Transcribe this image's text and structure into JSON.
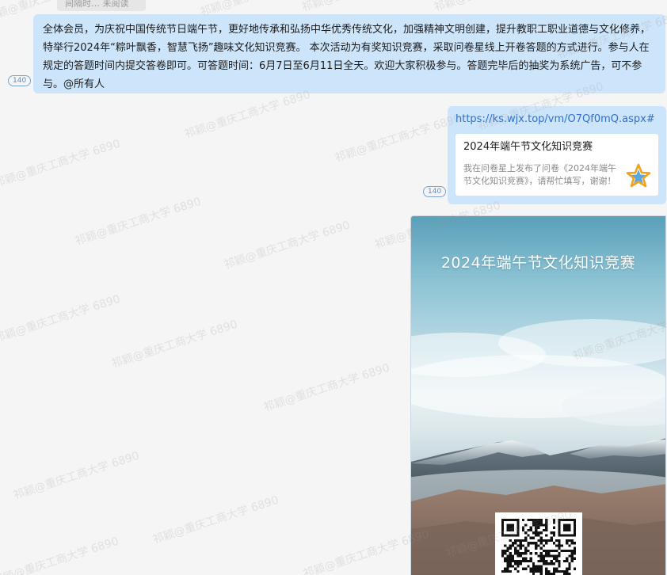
{
  "top_cut": {
    "label": "间隔时…  未阅读"
  },
  "watermark": {
    "text": "祁颖@重庆工商大学 6890"
  },
  "messages": [
    {
      "id": "announcement",
      "text": " 全体会员，为庆祝中国传统节日端午节，更好地传承和弘扬中华优秀传统文化，加强精神文明创建，提升教职工职业道德与文化修养，特举行2024年“粽叶飘香，智慧飞扬”趣味文化知识竞赛。 本次活动为有奖知识竞赛，采取问卷星线上开卷答题的方式进行。参与人在规定的答题时间内提交答卷即可。可答题时间：6月7日至6月11日全天。欢迎大家积极参与。答题完毕后的抽奖为系统广告，可不参与。@所有人",
      "read_count": "140"
    },
    {
      "id": "link",
      "url": "https://ks.wjx.top/vm/O7Qf0mQ.aspx#",
      "card_title": "2024年端午节文化知识竞赛",
      "card_desc": "我在问卷星上发布了问卷《2024年端午节文化知识竞赛》，请帮忙填写，谢谢！",
      "icon": "star-icon",
      "read_count": "140"
    },
    {
      "id": "poster",
      "poster_title": "2024年端午节文化知识竞赛",
      "image_desc": "poster-image"
    }
  ],
  "colors": {
    "bubble": "#cde5fa",
    "link": "#2e6fcf",
    "badge": "#5c8dc4",
    "background": "#f5f5f5"
  }
}
